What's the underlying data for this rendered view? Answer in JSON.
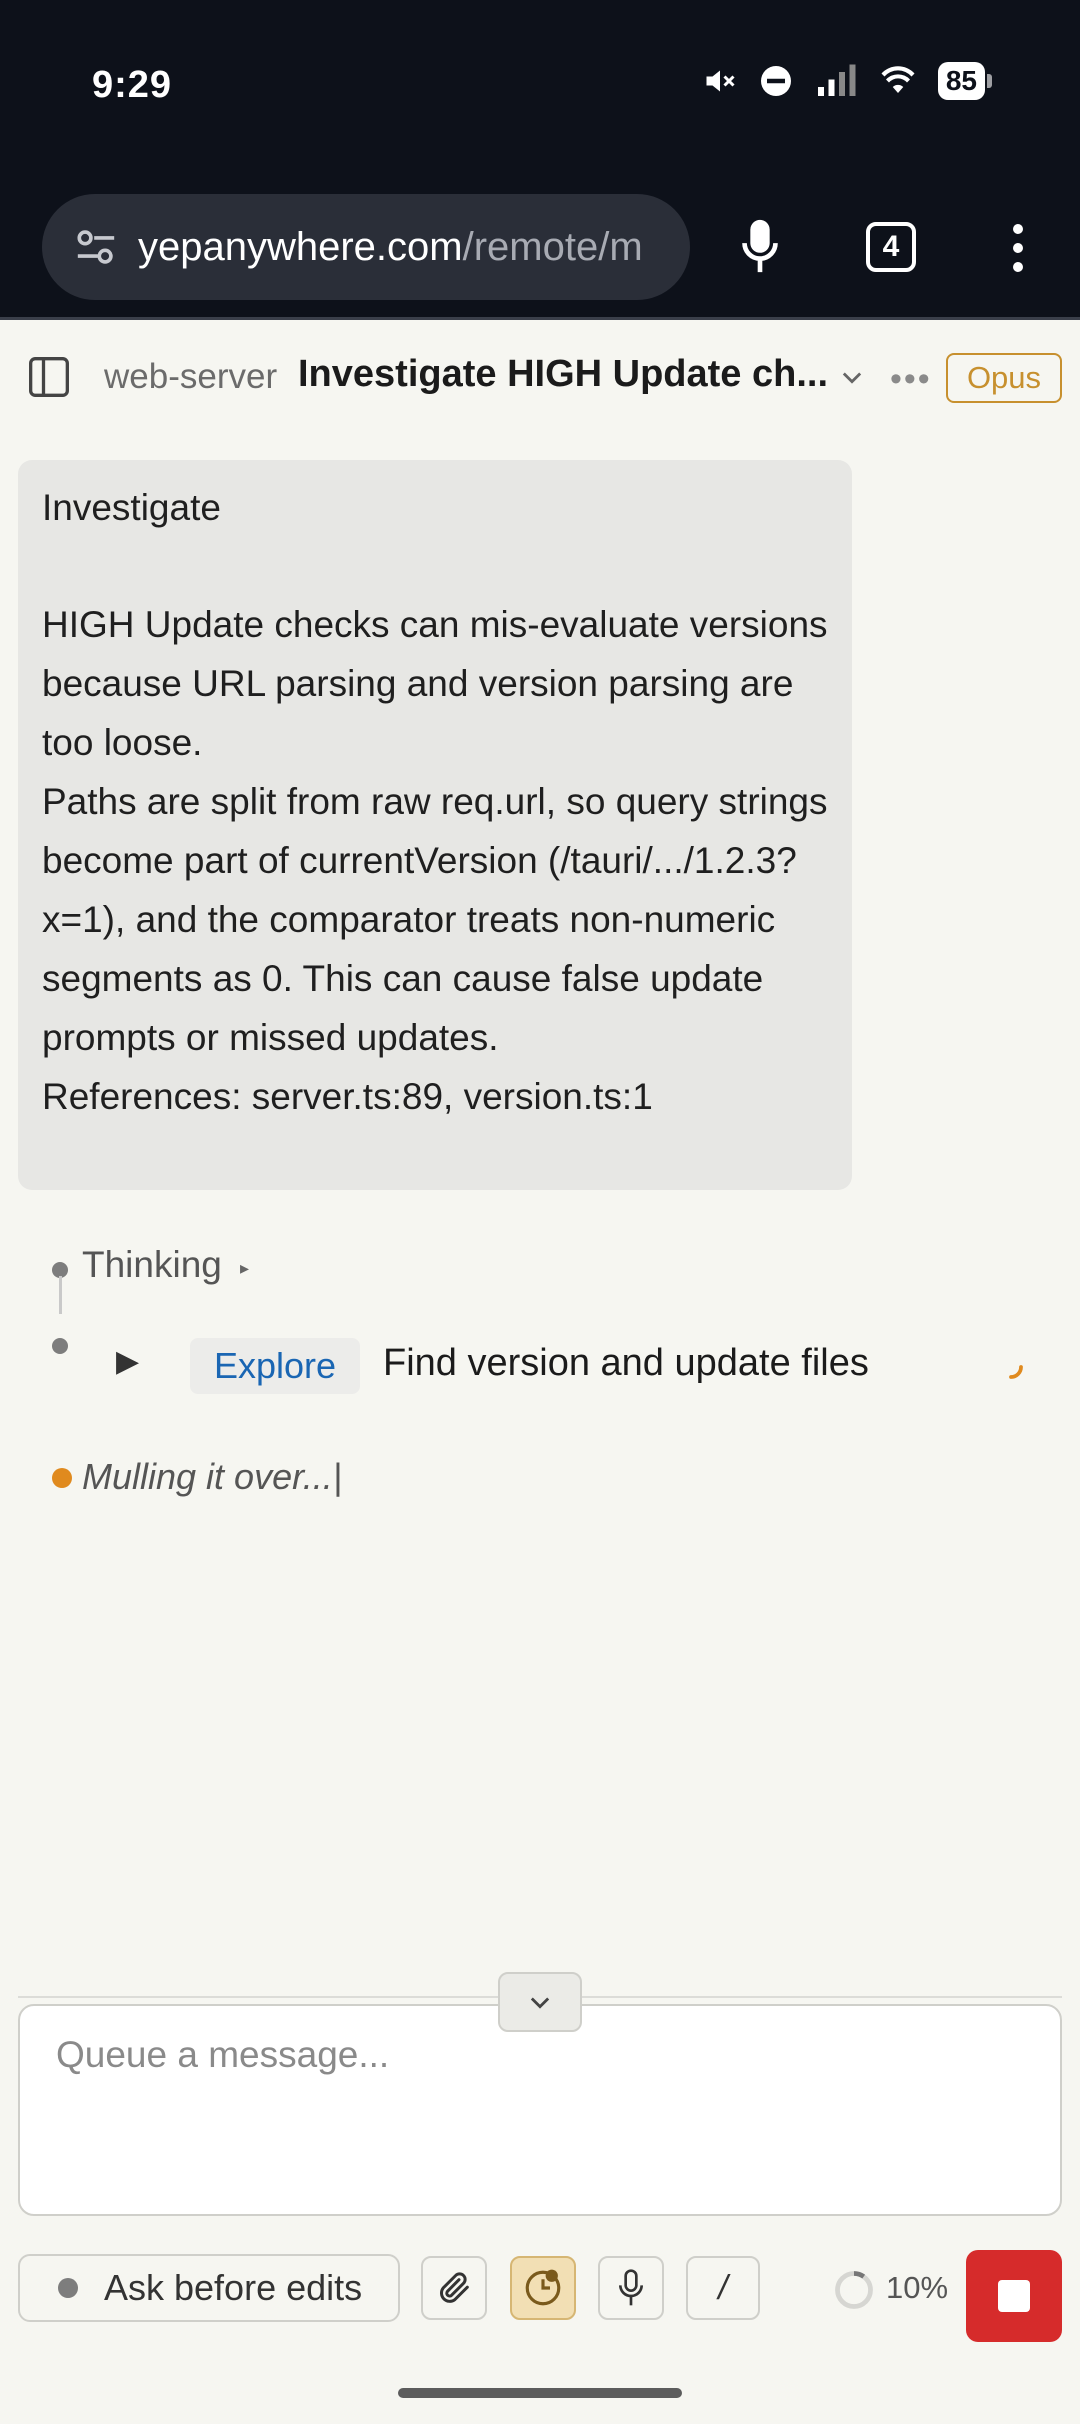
{
  "status_bar": {
    "time": "9:29",
    "battery": "85",
    "icons": [
      "mute-icon",
      "dnd-icon",
      "signal-icon",
      "wifi-icon",
      "battery-icon"
    ]
  },
  "browser": {
    "url_domain": "yepanywhere.com",
    "url_path": "/remote/m",
    "tab_count": "4"
  },
  "header": {
    "project": "web-server",
    "title": "Investigate HIGH Update ch...",
    "model": "Opus"
  },
  "user_message": {
    "line1": "Investigate",
    "para1": "HIGH Update checks can mis-evaluate versions because URL parsing and version parsing are too loose.",
    "para2": "Paths are split from raw req.url, so query strings become part of currentVersion (/tauri/.../1.2.3?x=1), and the comparator treats non-numeric segments as 0. This can cause false update prompts or missed updates.",
    "references": "References: server.ts:89, version.ts:1"
  },
  "timeline": {
    "thinking_label": "Thinking",
    "tool_name": "Explore",
    "tool_description": "Find version and update files",
    "status_text": "Mulling it over...|"
  },
  "composer": {
    "placeholder": "Queue a message...",
    "mode_label": "Ask before edits",
    "context_percent": "10%"
  },
  "colors": {
    "accent": "#c7902e",
    "stop": "#d62b2b",
    "link": "#1a66b3",
    "status_dot": "#e08a1e"
  }
}
